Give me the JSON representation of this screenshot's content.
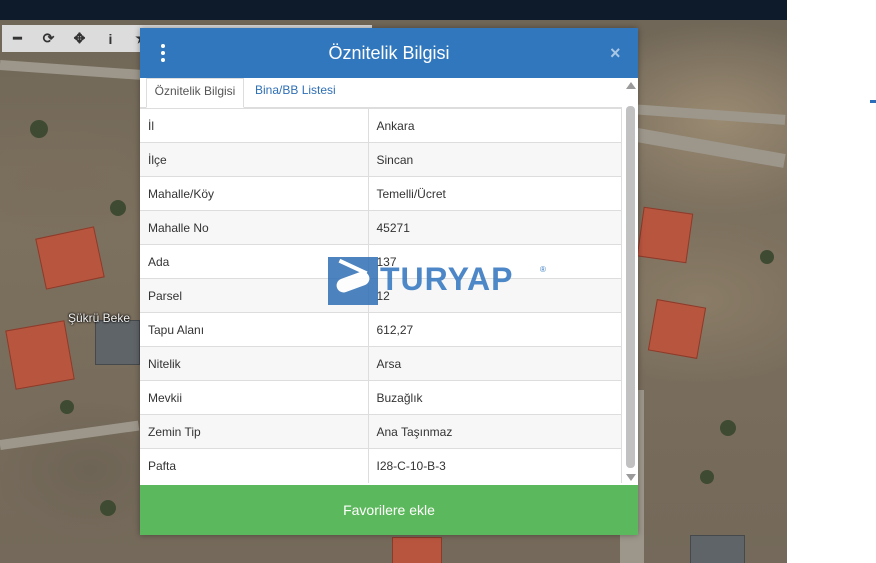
{
  "map": {
    "place_label": "Şükrü Beke",
    "toolbar": [
      {
        "icon": "minus-icon",
        "glyph": "━"
      },
      {
        "icon": "refresh-icon",
        "glyph": "⟳"
      },
      {
        "icon": "move-icon",
        "glyph": "✥"
      },
      {
        "icon": "info-icon",
        "glyph": "i"
      },
      {
        "icon": "star-icon",
        "glyph": "★"
      }
    ]
  },
  "dialog": {
    "title": "Öznitelik Bilgisi",
    "close_glyph": "×",
    "tabs": [
      {
        "label": "Öznitelik Bilgisi",
        "active": true
      },
      {
        "label": "Bina/BB Listesi",
        "active": false
      }
    ],
    "rows": [
      {
        "key": "İl",
        "value": "Ankara"
      },
      {
        "key": "İlçe",
        "value": "Sincan"
      },
      {
        "key": "Mahalle/Köy",
        "value": "Temelli/Ücret"
      },
      {
        "key": "Mahalle No",
        "value": "45271"
      },
      {
        "key": "Ada",
        "value": "137"
      },
      {
        "key": "Parsel",
        "value": "12"
      },
      {
        "key": "Tapu Alanı",
        "value": "612,27"
      },
      {
        "key": "Nitelik",
        "value": "Arsa"
      },
      {
        "key": "Mevkii",
        "value": "Buzağlık"
      },
      {
        "key": "Zemin Tip",
        "value": "Ana Taşınmaz"
      },
      {
        "key": "Pafta",
        "value": "I28-C-10-B-3"
      }
    ],
    "footer_button": "Favorilere ekle"
  },
  "watermark": {
    "text": "TURYAP",
    "reg": "®"
  },
  "colors": {
    "header": "#3177bd",
    "footer": "#5cb85c",
    "tab_link": "#2f6fb5"
  }
}
